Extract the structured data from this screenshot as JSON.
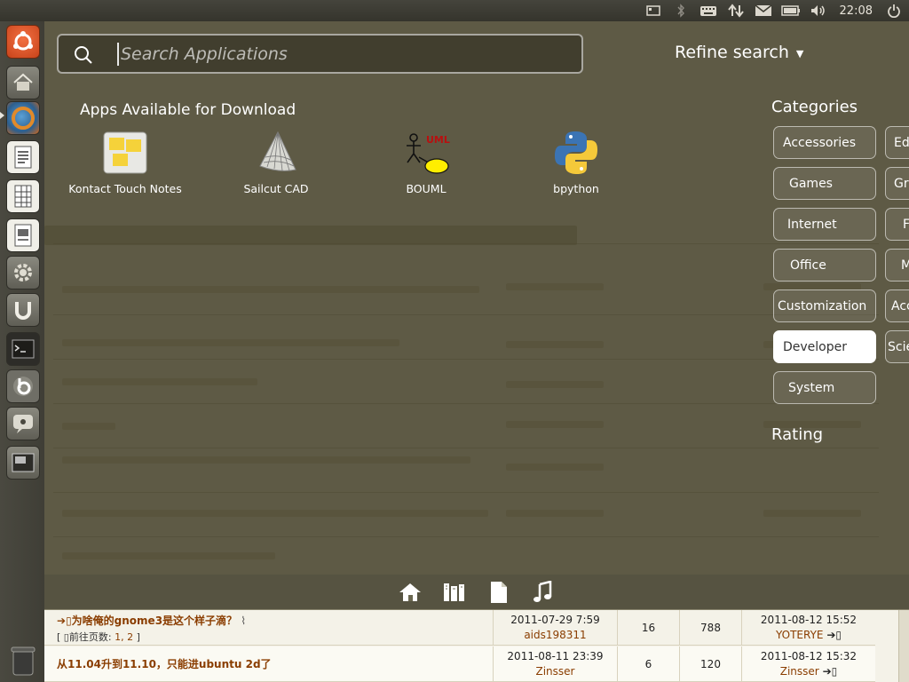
{
  "top_panel": {
    "clock": "22:08",
    "tray_icons": [
      "storage-icon",
      "bluetooth-icon",
      "keyboard-icon",
      "network-icon",
      "mail-icon",
      "battery-icon",
      "volume-icon",
      "power-icon"
    ]
  },
  "launcher": {
    "items": [
      "ubuntu-logo-icon",
      "home-folder-icon",
      "firefox-icon",
      "writer-icon",
      "calc-icon",
      "impress-icon",
      "settings-icon",
      "software-center-icon",
      "terminal-icon",
      "bittorrent-icon",
      "chat-icon",
      "screenshot-icon",
      "trash-icon"
    ]
  },
  "dash": {
    "search_placeholder": "Search Applications",
    "refine_label": "Refine search",
    "apps_heading": "Apps Available for Download",
    "apps": [
      {
        "label": "Kontact Touch Notes",
        "icon": "notes-icon"
      },
      {
        "label": "Sailcut CAD",
        "icon": "sail-icon"
      },
      {
        "label": "BOUML",
        "icon": "uml-icon",
        "badge": "UML"
      },
      {
        "label": "bpython",
        "icon": "python-icon"
      }
    ],
    "categories_heading": "Categories",
    "categories_col1": [
      "Accessories",
      "Games",
      "Internet",
      "Office",
      "Customization",
      "Developer",
      "System"
    ],
    "categories_col2": [
      "Ed",
      "Gr",
      "F",
      "M",
      "Acc",
      "Scie"
    ],
    "active_category": "Developer",
    "rating_heading": "Rating",
    "lens_icons": [
      "home-lens-icon",
      "apps-lens-icon",
      "files-lens-icon",
      "music-lens-icon"
    ]
  },
  "forum": {
    "rows": [
      {
        "title": "为啥俺的gnome3是这个样子滴？",
        "pages_prefix": "[ ",
        "pages_label": "前往页数:",
        "page_links": "1, 2",
        "pages_suffix": " ]",
        "date": "2011-07-29 7:59",
        "author": "aids198311",
        "replies": "16",
        "views": "788",
        "last_date": "2011-08-12 15:52",
        "last_author": "YOTERYE"
      },
      {
        "title": "从11.04升到11.10，只能进ubuntu 2d了",
        "date": "2011-08-11 23:39",
        "author": "Zinsser",
        "replies": "6",
        "views": "120",
        "last_date": "2011-08-12 15:32",
        "last_author": "Zinsser"
      }
    ]
  },
  "colors": {
    "forum_link": "#8a3d00",
    "dash_tint": "#3c3a28",
    "active_category_bg": "#ffffff"
  }
}
